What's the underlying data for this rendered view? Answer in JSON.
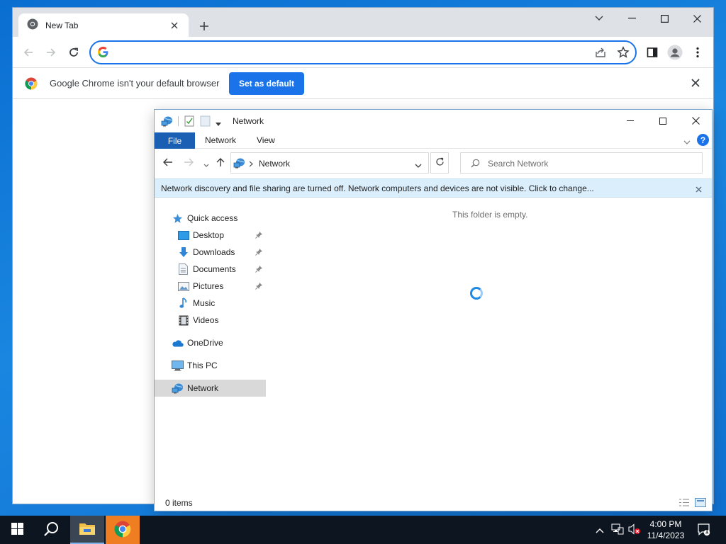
{
  "chrome": {
    "tab_title": "New Tab",
    "omnibox_value": "",
    "infobar_text": "Google Chrome isn't your default browser",
    "set_default_label": "Set as default"
  },
  "explorer": {
    "title": "Network",
    "ribbon_tabs": [
      "File",
      "Network",
      "View"
    ],
    "address_location": "Network",
    "search_placeholder": "Search Network",
    "infobar_text": "Network discovery and file sharing are turned off. Network computers and devices are not visible. Click to change...",
    "nav": {
      "quick_access": "Quick access",
      "desktop": "Desktop",
      "downloads": "Downloads",
      "documents": "Documents",
      "pictures": "Pictures",
      "music": "Music",
      "videos": "Videos",
      "onedrive": "OneDrive",
      "this_pc": "This PC",
      "network": "Network"
    },
    "empty_message": "This folder is empty.",
    "item_count": "0 items"
  },
  "taskbar": {
    "time": "4:00 PM",
    "date": "11/4/2023",
    "notification_count": "1"
  },
  "colors": {
    "accent": "#1a73e8",
    "file_tab": "#1a5fb4",
    "infobar_bg": "#dbeefc",
    "taskbar_bg": "#0c1520"
  }
}
